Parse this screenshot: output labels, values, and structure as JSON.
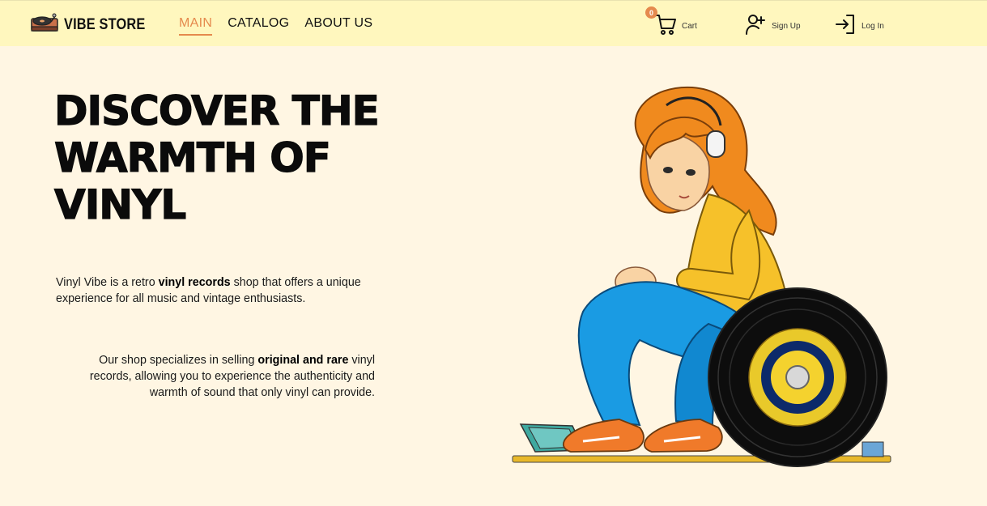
{
  "header": {
    "brand": "VIBE STORE",
    "nav": [
      {
        "label": "MAIN",
        "active": true
      },
      {
        "label": "CATALOG",
        "active": false
      },
      {
        "label": "ABOUT US",
        "active": false
      }
    ],
    "cart": {
      "label": "Cart",
      "count": "0",
      "icon": "cart-icon"
    },
    "signup": {
      "label": "Sign Up",
      "icon": "user-plus-icon"
    },
    "login": {
      "label": "Log In",
      "icon": "login-icon"
    },
    "accent_color": "#E58A4E",
    "background_color": "#FFF7BE"
  },
  "hero": {
    "title_lines": [
      "DISCOVER THE",
      "WARMTH OF",
      "VINYL"
    ],
    "para1": {
      "pre": "Vinyl Vibe is a retro ",
      "bold": "vinyl records",
      "post": " shop that offers a unique experience for all music and vintage enthusiasts."
    },
    "para2": {
      "pre": "Our shop specializes in selling ",
      "bold": "original and rare",
      "post": " vinyl records, allowing you to experience the authenticity and warmth of sound that only vinyl can provide."
    },
    "illustration": "girl-with-headphones-and-vinyl-record-illustration"
  },
  "page": {
    "background_color": "#FFF6E3"
  }
}
